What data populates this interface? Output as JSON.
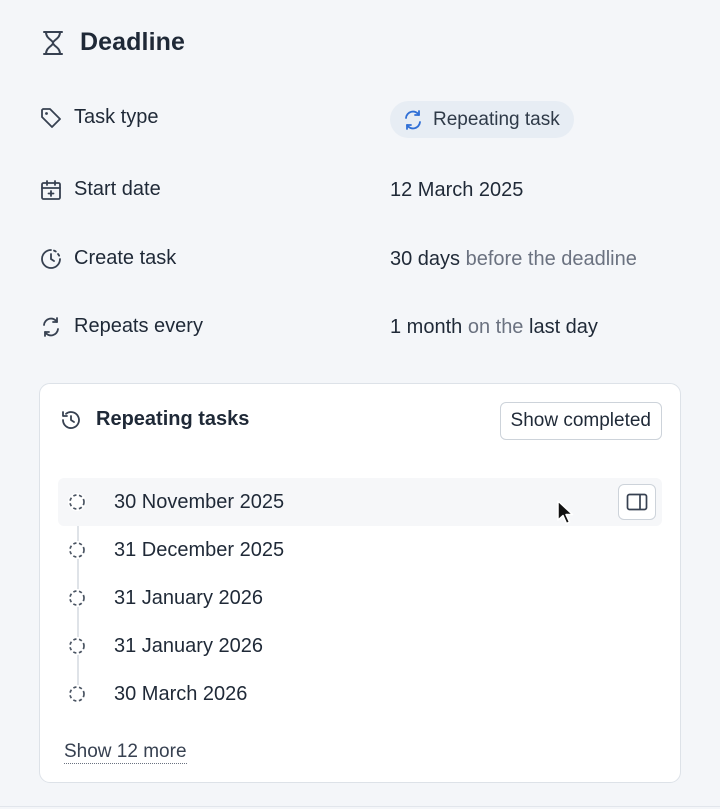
{
  "header": {
    "title": "Deadline",
    "icon": "hourglass-icon"
  },
  "fields": {
    "task_type": {
      "label": "Task type",
      "value": "Repeating task"
    },
    "start_date": {
      "label": "Start date",
      "value": "12 March 2025"
    },
    "create_task": {
      "label": "Create task",
      "amount": "30 days",
      "suffix": "before the deadline"
    },
    "repeats_every": {
      "label": "Repeats every",
      "amount": "1 month",
      "connector": "on the",
      "day": "last day"
    }
  },
  "repeating": {
    "title": "Repeating tasks",
    "show_completed_label": "Show completed",
    "items": [
      {
        "date": "30 November 2025"
      },
      {
        "date": "31 December 2025"
      },
      {
        "date": "31 January 2026"
      },
      {
        "date": "31 January 2026"
      },
      {
        "date": "30 March 2026"
      }
    ],
    "show_more_label": "Show 12 more"
  },
  "colors": {
    "accent": "#2f6fd6",
    "pill_bg": "#e7edf4",
    "page_bg": "#f4f6f9"
  }
}
